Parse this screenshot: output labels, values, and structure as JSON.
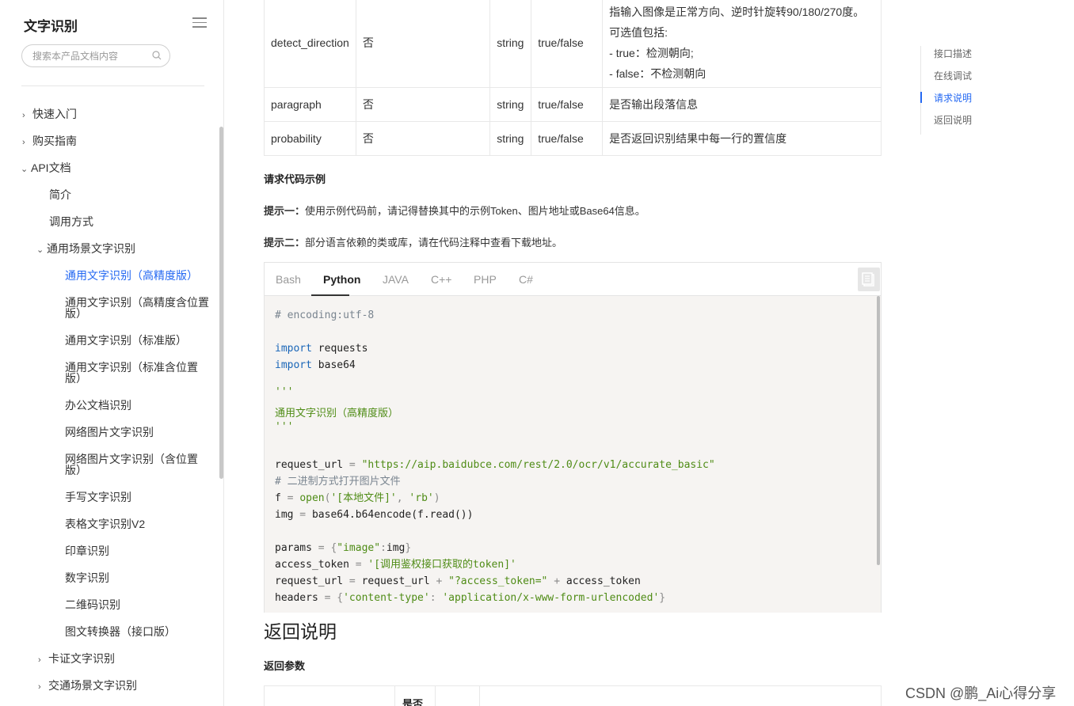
{
  "sidebar": {
    "title": "文字识别",
    "search_placeholder": "搜索本产品文档内容",
    "items": [
      {
        "label": "快速入门",
        "chevron": "›"
      },
      {
        "label": "购买指南",
        "chevron": "›"
      },
      {
        "label": "API文档",
        "chevron": "⌄"
      },
      {
        "label": "简介"
      },
      {
        "label": "调用方式"
      },
      {
        "label": "通用场景文字识别",
        "chevron": "⌄"
      },
      {
        "label": "通用文字识别（高精度版）"
      },
      {
        "label": "通用文字识别（高精度含位置版）"
      },
      {
        "label": "通用文字识别（标准版）"
      },
      {
        "label": "通用文字识别（标准含位置版）"
      },
      {
        "label": "办公文档识别"
      },
      {
        "label": "网络图片文字识别"
      },
      {
        "label": "网络图片文字识别（含位置版）"
      },
      {
        "label": "手写文字识别"
      },
      {
        "label": "表格文字识别V2"
      },
      {
        "label": "印章识别"
      },
      {
        "label": "数字识别"
      },
      {
        "label": "二维码识别"
      },
      {
        "label": "图文转换器（接口版）"
      },
      {
        "label": "卡证文字识别",
        "chevron": "›"
      },
      {
        "label": "交通场景文字识别",
        "chevron": "›"
      }
    ]
  },
  "params_table": {
    "rows": [
      {
        "name": "detect_direction",
        "required": "否",
        "type": "string",
        "values": "true/false",
        "desc": [
          "指输入图像是正常方向、逆时针旋转90/180/270度。",
          "可选值包括:",
          "- true：检测朝向;",
          "- false：不检测朝向"
        ]
      },
      {
        "name": "paragraph",
        "required": "否",
        "type": "string",
        "values": "true/false",
        "desc": [
          "是否输出段落信息"
        ]
      },
      {
        "name": "probability",
        "required": "否",
        "type": "string",
        "values": "true/false",
        "desc": [
          "是否返回识别结果中每一行的置信度"
        ]
      }
    ]
  },
  "content": {
    "code_heading": "请求代码示例",
    "tip1_label": "提示一：",
    "tip1_text": "使用示例代码前，请记得替换其中的示例Token、图片地址或Base64信息。",
    "tip2_label": "提示二：",
    "tip2_text": "部分语言依赖的类或库，请在代码注释中查看下载地址。",
    "tabs": [
      "Bash",
      "Python",
      "JAVA",
      "C++",
      "PHP",
      "C#"
    ],
    "active_tab": "Python",
    "code": {
      "l1": "# encoding:utf-8",
      "kw_import": "import",
      "mod_requests": " requests",
      "mod_base64": " base64",
      "triple_q": "'''",
      "doc": "通用文字识别（高精度版）",
      "req_url_var": "request_url",
      "eq": " = ",
      "url": "\"https://aip.baidubce.com/rest/2.0/ocr/v1/accurate_basic\"",
      "comment_bin": "# 二进制方式打开图片文件",
      "f_var": "f",
      "open_fn": "open",
      "open_args_1": "'[本地文件]'",
      "open_args_2": "'rb'",
      "img_line": "img",
      "b64call": "base64.b64encode(f.read())",
      "params_var": "params",
      "params_key": "\"image\"",
      "params_val": "img",
      "token_var": "access_token",
      "token_val": "'[调用鉴权接口获取的token]'",
      "req_url_2a": "request_url",
      "req_url_2b": "\"?access_token=\"",
      "headers_var": "headers",
      "headers_k": "'content-type'",
      "headers_v": "'application/x-www-form-urlencoded'"
    },
    "return_title": "返回说明",
    "return_params_heading": "返回参数",
    "return_table_head": "是否"
  },
  "toc": {
    "items": [
      "接口描述",
      "在线调试",
      "请求说明",
      "返回说明"
    ],
    "active": "请求说明"
  },
  "watermark": "CSDN @鹏_Ai心得分享",
  "colors": {
    "accent": "#2468f2",
    "code_bg": "#f6f4f2",
    "keyword": "#1a66b8",
    "string": "#4f8c16",
    "comment": "#7a8590"
  }
}
